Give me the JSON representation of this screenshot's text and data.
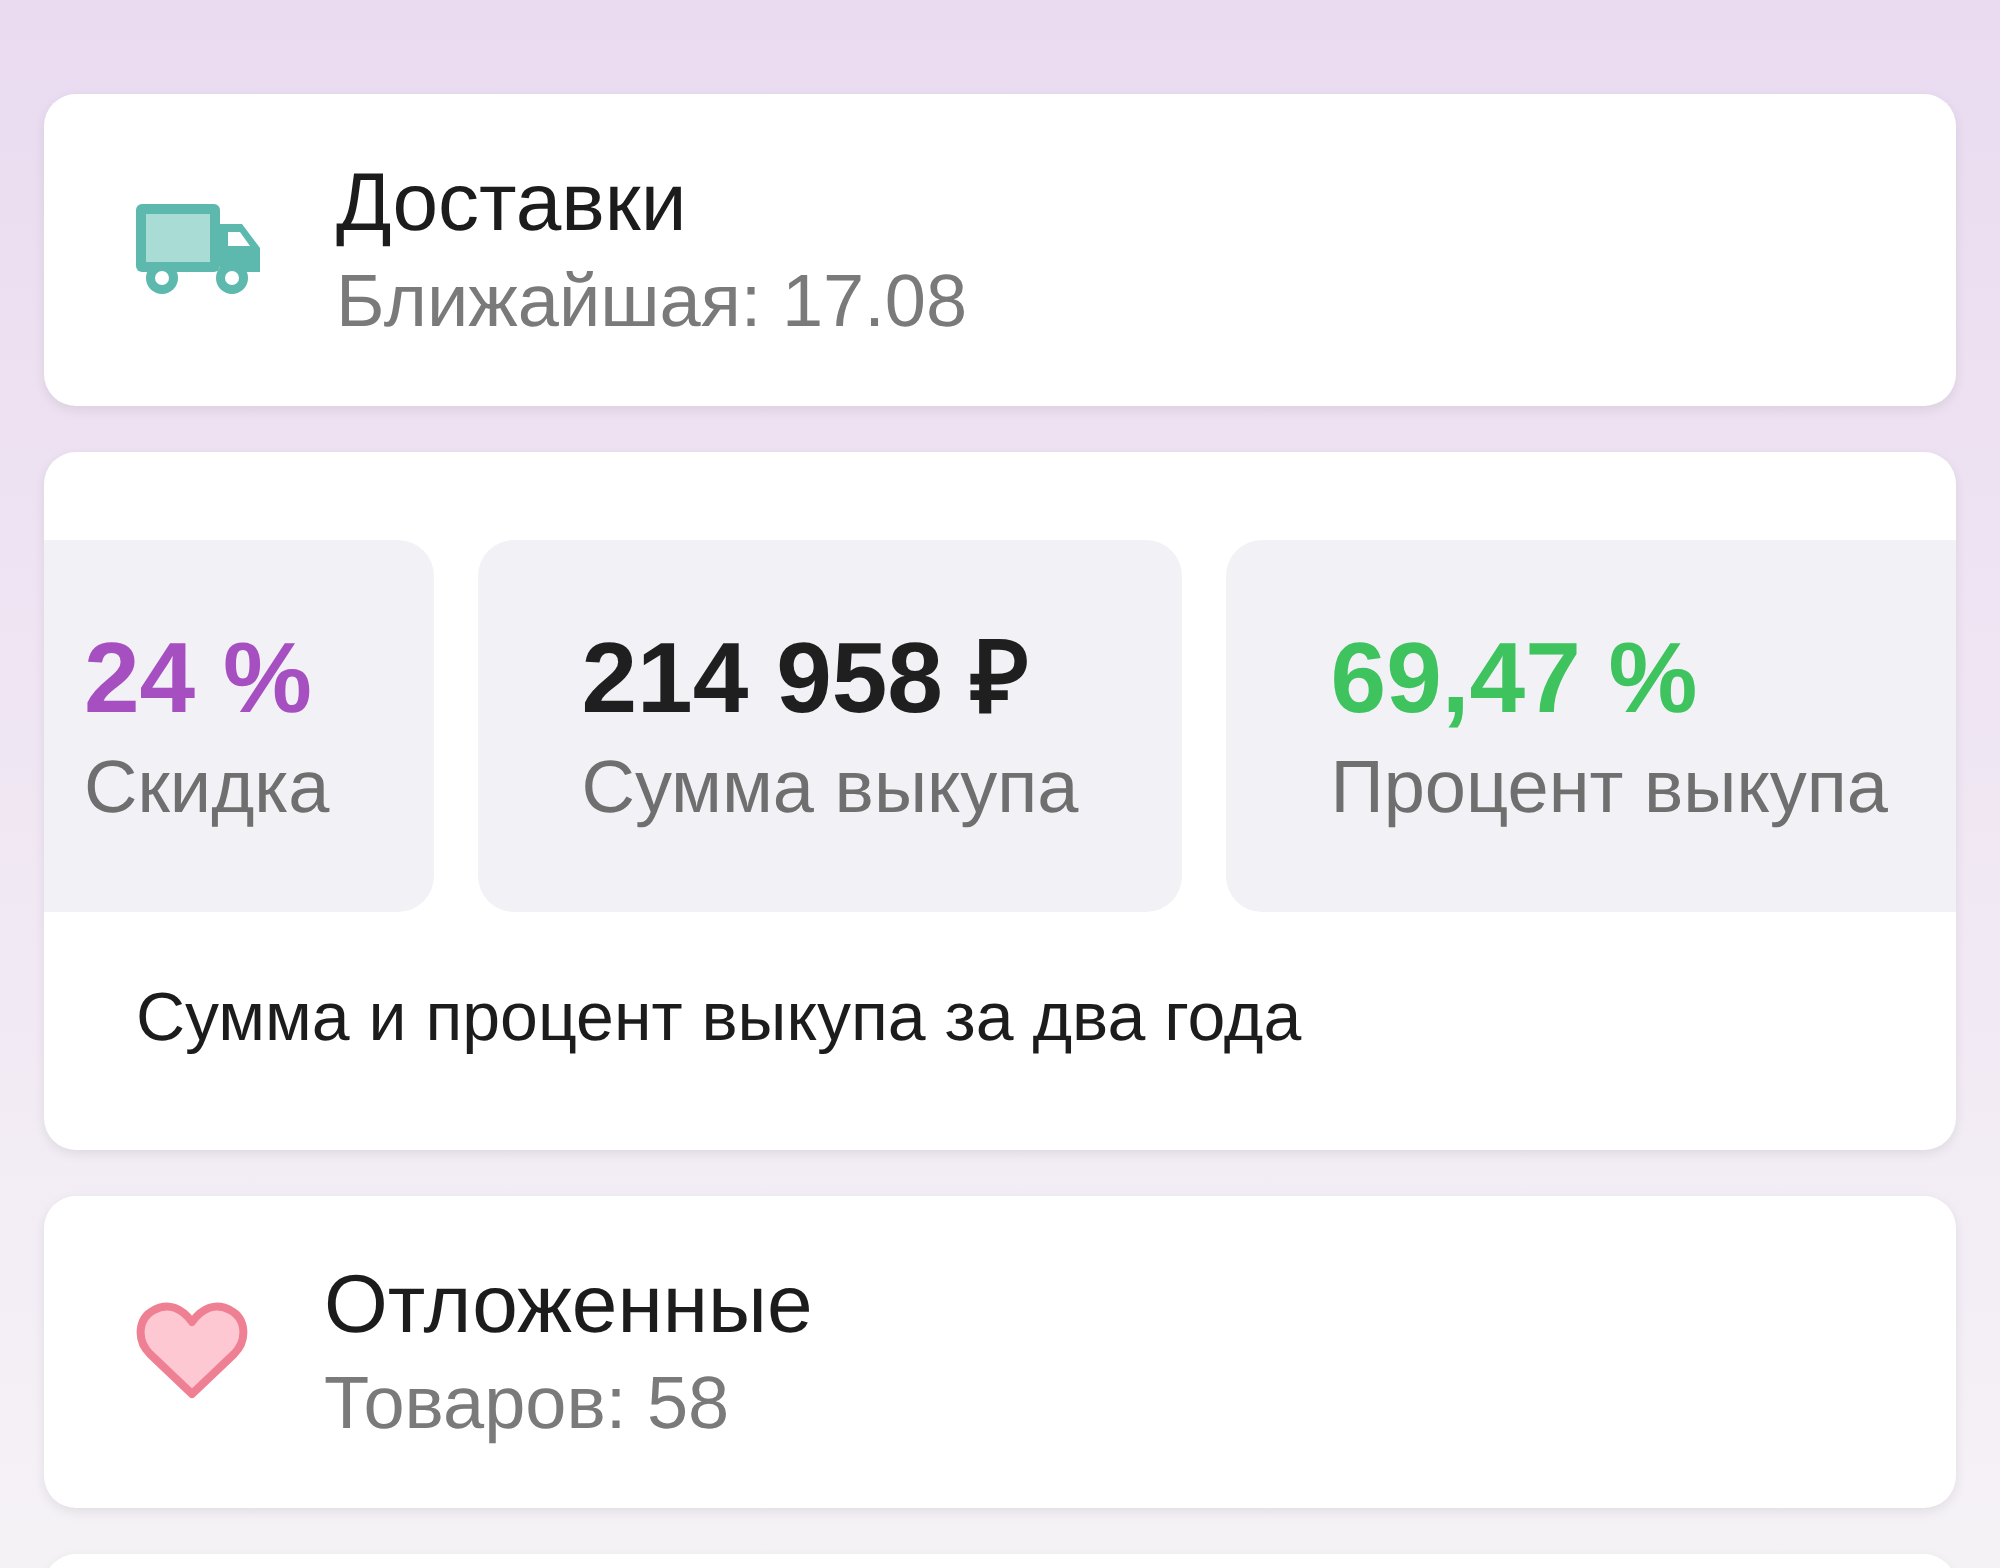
{
  "deliveries": {
    "title": "Доставки",
    "subtitle": "Ближайшая: 17.08"
  },
  "stats": {
    "tiles": [
      {
        "value": "24 %",
        "label": "Скидка",
        "color": "#a64fc1"
      },
      {
        "value": "214 958 ₽",
        "label": "Сумма выкупа",
        "color": "#1f1f1f"
      },
      {
        "value": "69,47 %",
        "label": "Процент выкупа",
        "color": "#3ec35f"
      }
    ],
    "caption": "Сумма и процент выкупа за два года"
  },
  "saved": {
    "title": "Отложенные",
    "subtitle": "Товаров: 58"
  }
}
